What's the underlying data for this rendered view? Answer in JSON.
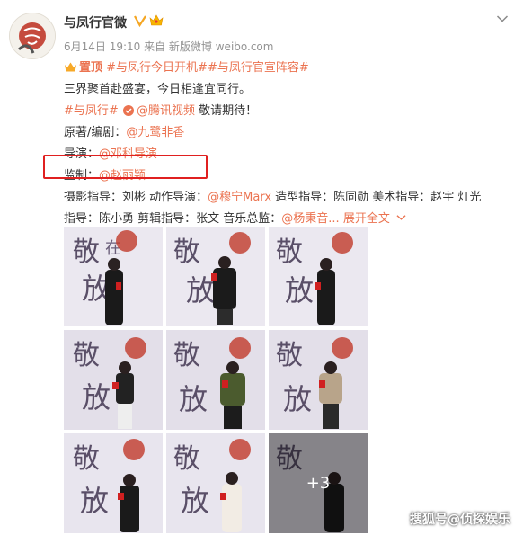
{
  "post": {
    "author": "与凤行官微",
    "meta": "6月14日 19:10 来自 新版微博 weibo.com",
    "pinned_label": "置顶",
    "pinned_topics": "#与凤行今日开机##与凤行官宣阵容#",
    "line2": "三界聚首赴盛宴，今日相逢宜同行。",
    "line3_tag": "#与凤行#",
    "line3_mention": "@腾讯视频",
    "line3_rest": " 敬请期待！",
    "line4_label": "原著/编剧：",
    "line4_mention": "@九鹭非香",
    "line5_label": "导演：",
    "line5_mention": "@邓科导演",
    "line6_label": "监制：",
    "line6_mention": "@赵丽颖",
    "line7_a": "摄影指导：刘彬 动作导演：",
    "line7_mention": "@穆宁Marx",
    "line7_b": " 造型指导：陈同勋 美术指导：赵宇 灯光",
    "line8_a": "指导：陈小勇 剪辑指导：张文 音乐总监：",
    "line8_mention": "@杨秉音...",
    "expand_label": "展开全文",
    "more_photos": "+3"
  },
  "watermark": "搜狐号@侦探娱乐",
  "colors": {
    "accent": "#eb7350",
    "highlight": "#e02020",
    "verified": "#f5a623"
  },
  "icons": [
    "avatar-logo",
    "verified-icon",
    "crown-icon",
    "chevron-down-icon",
    "pin-icon",
    "topic-icon"
  ]
}
